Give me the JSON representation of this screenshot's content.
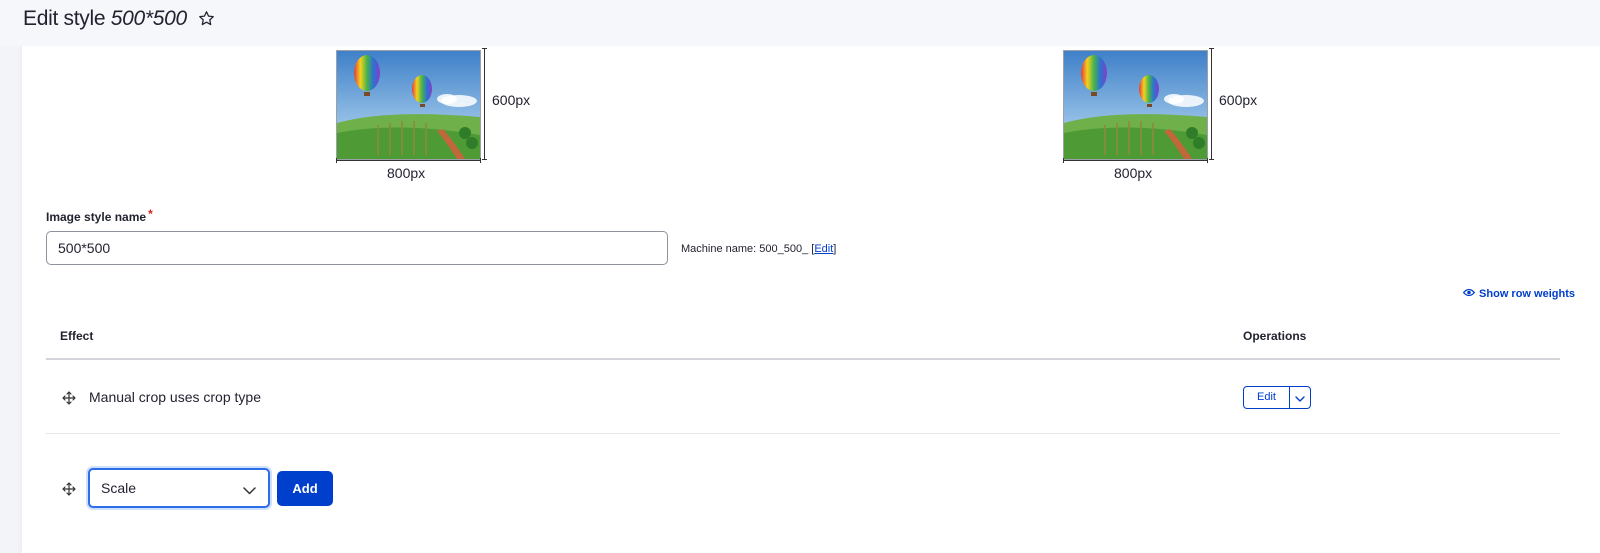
{
  "header": {
    "title_prefix": "Edit style",
    "title_name": "500*500"
  },
  "preview": {
    "original": {
      "width_label": "800px",
      "height_label": "600px"
    },
    "derivative": {
      "width_label": "800px",
      "height_label": "600px"
    }
  },
  "form": {
    "label": "Image style name",
    "required_mark": "*",
    "value": "500*500",
    "machine_name_prefix": "Machine name: 500_500_ [",
    "machine_name_link": "Edit",
    "machine_name_suffix": "]"
  },
  "table": {
    "show_weights": "Show row weights",
    "col_effect": "Effect",
    "col_operations": "Operations",
    "rows": [
      {
        "effect": "Manual crop uses crop type",
        "op": "Edit"
      }
    ]
  },
  "new_effect": {
    "selected": "Scale",
    "add_label": "Add"
  },
  "colors": {
    "accent": "#003ecc",
    "required": "#dc2323",
    "focus": "#2c6de8"
  }
}
